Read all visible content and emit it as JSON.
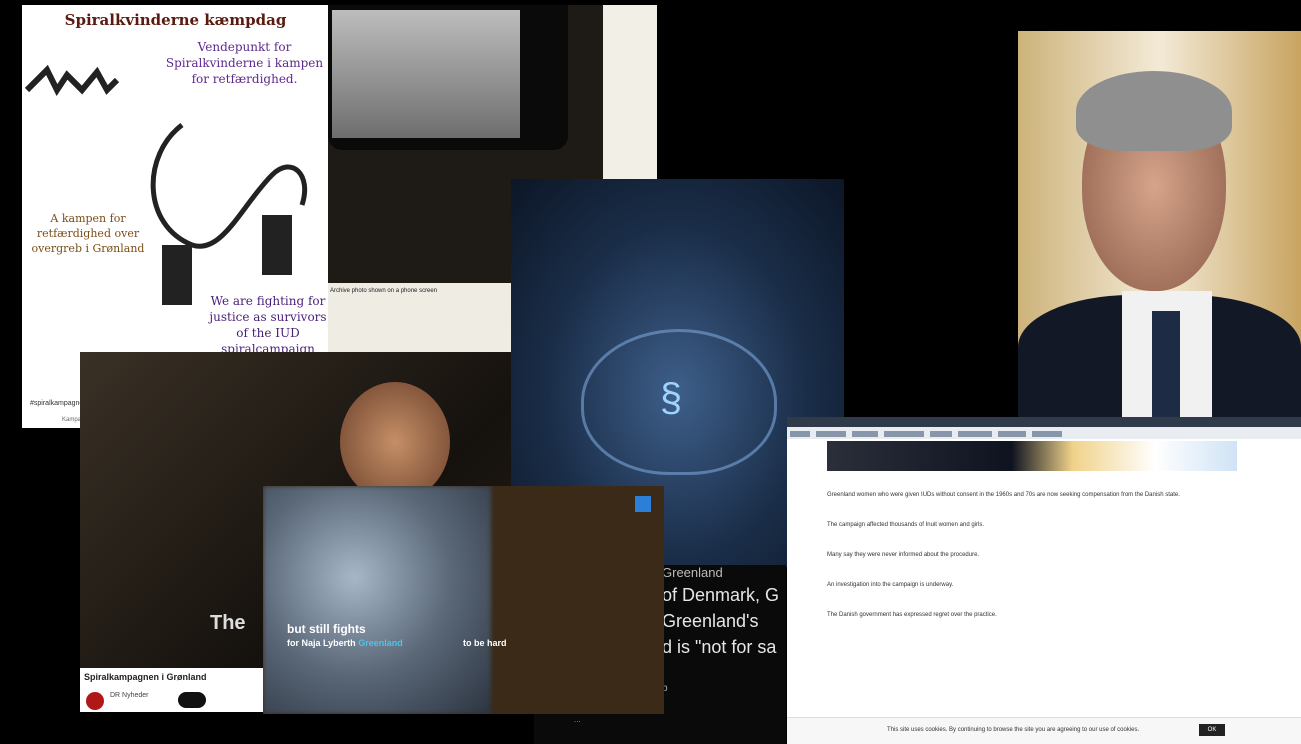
{
  "poster": {
    "title": "Spiralkvinderne kæmpdag",
    "purple_text": "Vendepunkt for Spiralkvinderne i kampen for retfærdighed.",
    "brown_text": "A kampen for retfærdighed over overgreb i Grønland",
    "right_text": "We are fighting for justice as survivors of the IUD spiralcampaign against us.",
    "footer": "#spiralkampagne",
    "footer_small": "Kampagne"
  },
  "phone_photo": {
    "caption": "Archive photo shown on a phone screen"
  },
  "woman_photo": {
    "overlay": "The",
    "headline": "Spiralkampagnen i Grønland",
    "source": "DR Nyheder"
  },
  "video_overlay": {
    "line1": "but still fights",
    "line2": "for Naja Lyberth",
    "highlight": "Greenland",
    "line3": "to be hard"
  },
  "news_panel": {
    "line0": "Greenland",
    "line1": "of Denmark, G",
    "line2": "Greenland's",
    "line3": "d is \"not for sa",
    "bottom": "b",
    "caption": "..."
  },
  "browser": {
    "paragraphs": [
      "Greenland women who were given IUDs without consent in the 1960s and 70s are now seeking compensation from the Danish state.",
      "The campaign affected thousands of Inuit women and girls.",
      "Many say they were never informed about the procedure.",
      "An investigation into the campaign is underway.",
      "The Danish government has expressed regret over the practice."
    ],
    "cookie_text": "This site uses cookies. By continuing to browse the site you are agreeing to our use of cookies.",
    "cookie_button": "OK"
  }
}
